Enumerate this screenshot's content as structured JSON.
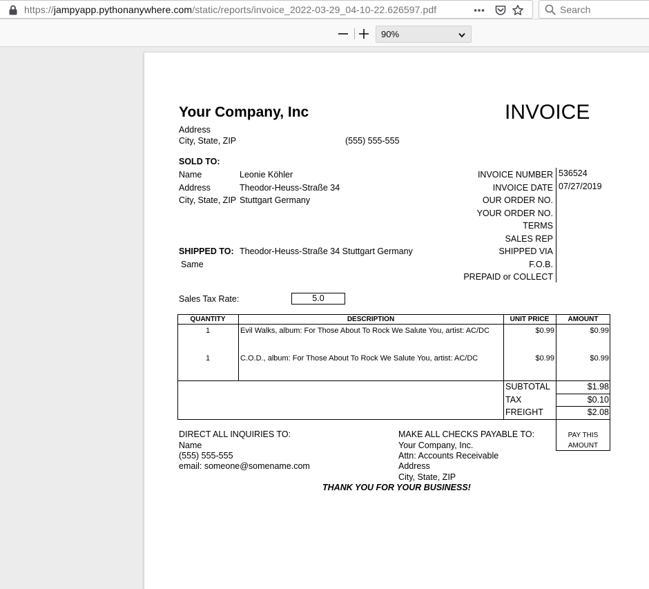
{
  "browser": {
    "url_prefix": "https://",
    "url_host": "jampyapp.pythonanywhere.com",
    "url_path": "/static/reports/invoice_2022-03-29_04-10-22.626597.pdf",
    "search_placeholder": "Search",
    "zoom_value": "90%"
  },
  "invoice": {
    "company_name": "Your Company, Inc",
    "doc_title": "INVOICE",
    "company_address": "Address",
    "company_city": "City, State, ZIP",
    "company_phone": "(555) 555-555",
    "sold_to_heading": "SOLD TO:",
    "sold_to": [
      {
        "label": "Name",
        "value": "Leonie Köhler"
      },
      {
        "label": "Address",
        "value": "Theodor-Heuss-Straße 34"
      },
      {
        "label": "City, State, ZIP",
        "value": "Stuttgart  Germany"
      }
    ],
    "shipped_to_heading": "SHIPPED TO:",
    "shipped_to_value": "Theodor-Heuss-Straße 34 Stuttgart  Germany",
    "shipped_to_note": "Same",
    "meta": [
      {
        "label": "INVOICE NUMBER",
        "value": "536524"
      },
      {
        "label": "INVOICE DATE",
        "value": "07/27/2019"
      },
      {
        "label": "OUR ORDER NO.",
        "value": ""
      },
      {
        "label": "YOUR ORDER NO.",
        "value": ""
      },
      {
        "label": "TERMS",
        "value": ""
      },
      {
        "label": "SALES REP",
        "value": ""
      },
      {
        "label": "SHIPPED VIA",
        "value": ""
      },
      {
        "label": "F.O.B.",
        "value": ""
      },
      {
        "label": "PREPAID or COLLECT",
        "value": ""
      }
    ],
    "tax_rate_label": "Sales Tax Rate:",
    "tax_rate_value": "5.0",
    "columns": {
      "quantity": "QUANTITY",
      "description": "DESCRIPTION",
      "unit_price": "UNIT PRICE",
      "amount": "AMOUNT"
    },
    "items": [
      {
        "quantity": "1",
        "description": "Evil Walks, album: For Those About To Rock We Salute You, artist: AC/DC",
        "unit_price": "$0.99",
        "amount": "$0.99"
      },
      {
        "quantity": "1",
        "description": "C.O.D., album: For Those About To Rock We Salute You, artist: AC/DC",
        "unit_price": "$0.99",
        "amount": "$0.99"
      }
    ],
    "totals": {
      "subtotal_label": "SUBTOTAL",
      "subtotal": "$1.98",
      "tax_label": "TAX",
      "tax": "$0.10",
      "freight_label": "FREIGHT",
      "freight": "$2.08"
    },
    "pay_box_line1": "PAY THIS",
    "pay_box_line2": "AMOUNT",
    "inquiries": {
      "heading": "DIRECT ALL INQUIRIES TO:",
      "name": "Name",
      "phone": "(555) 555-555",
      "email": "email: someone@somename.com"
    },
    "checks": {
      "heading": "MAKE ALL CHECKS PAYABLE TO:",
      "company": "Your Company, Inc.",
      "attn": "Attn: Accounts Receivable",
      "address": "Address",
      "city": "City, State, ZIP"
    },
    "thank_you": "THANK YOU FOR YOUR BUSINESS!"
  }
}
